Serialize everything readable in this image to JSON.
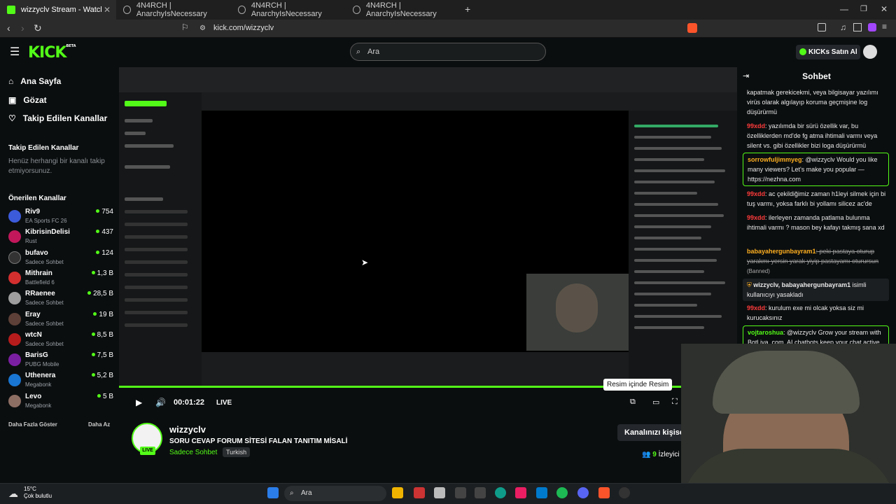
{
  "tabs": [
    {
      "title": "wizzyclv Stream - Watch Live on",
      "active": true
    },
    {
      "title": "4N4RCH | AnarchyIsNecessary"
    },
    {
      "title": "4N4RCH | AnarchyIsNecessary"
    },
    {
      "title": "4N4RCH | AnarchyIsNecessary"
    }
  ],
  "browser": {
    "url": "kick.com/wizzyclv",
    "new_tab": "+"
  },
  "header": {
    "logo": "KICK",
    "logo_sup": "BETA",
    "search_placeholder": "Ara",
    "buy_kicks": "KICKs Satın Al"
  },
  "sidebar": {
    "nav": [
      "Ana Sayfa",
      "Gözat",
      "Takip Edilen Kanallar"
    ],
    "followed_title": "Takip Edilen Kanallar",
    "followed_empty": "Henüz herhangi bir kanalı takip etmiyorsunuz.",
    "recommended_title": "Önerilen Kanallar",
    "channels": [
      {
        "name": "Riv9",
        "category": "EA Sports FC 26",
        "viewers": "754",
        "color": "#3b5bdb"
      },
      {
        "name": "KibrisinDelisi",
        "category": "Rust",
        "viewers": "437",
        "color": "#c2185b"
      },
      {
        "name": "bufavo",
        "category": "Sadece Sohbet",
        "viewers": "124",
        "color": "#333333"
      },
      {
        "name": "Mithrain",
        "category": "Battlefield 6",
        "viewers": "1,3 B",
        "color": "#d32f2f"
      },
      {
        "name": "RRaenee",
        "category": "Sadece Sohbet",
        "viewers": "28,5 B",
        "color": "#9e9e9e"
      },
      {
        "name": "Eray",
        "category": "Sadece Sohbet",
        "viewers": "19 B",
        "color": "#5d4037"
      },
      {
        "name": "wtcN",
        "category": "Sadece Sohbet",
        "viewers": "8,5 B",
        "color": "#b71c1c"
      },
      {
        "name": "BarisG",
        "category": "PUBG Mobile",
        "viewers": "7,5 B",
        "color": "#7b1fa2"
      },
      {
        "name": "Uthenera",
        "category": "Megabonk",
        "viewers": "5,2 B",
        "color": "#1976d2"
      },
      {
        "name": "Levo",
        "category": "Megabonk",
        "viewers": "5 B",
        "color": "#8d6e63"
      }
    ],
    "show_more": "Daha Fazla Göster",
    "show_less": "Daha Az"
  },
  "player": {
    "time": "00:01:22",
    "live": "LIVE",
    "tooltip": "Resim içinde Resim"
  },
  "stream": {
    "streamer": "wizzyclv",
    "title": "SORU CEVAP FORUM SİTESİ FALAN TANITIM MİSALİ",
    "category": "Sadece Sohbet",
    "tag": "Turkish",
    "customize": "Kanalınızı kişiselleştirin",
    "viewers_count": "9",
    "viewers_label": "İzleyici"
  },
  "chat": {
    "title": "Sohbet",
    "messages": [
      {
        "user": "",
        "text": "kapatmak gerekicekmi, veya bilgisayar yazılımı virüs olarak algılayıp koruma geçmişine log düşürürmü",
        "color": "#ffffff"
      },
      {
        "user": "99xdd",
        "text": ": yazılımda bir sürü özellik var, bu özelliklerden md'de fg atma ihtimali varmı veya silent vs. gibi özellikler bizi loga düşürürmü",
        "color": "#ff3b3b"
      },
      {
        "user": "sorrowfuljimmyeg",
        "text": ": @wizzyclv Would you like many viewers? Let's make you popular — https://nezhna.com",
        "color": "#ffb020"
      },
      {
        "user": "99xdd",
        "text": ": ac çekildiğimiz zaman h1leyi silmek için bi tuş varmı, yoksa farklı bi yollamı silicez ac'de",
        "color": "#ff3b3b"
      },
      {
        "user": "99xdd",
        "text": ": ilerleyen zamanda patlama bulunma ihtimali varmı ? mason bey kafayı takmış sana xd",
        "color": "#ff3b3b"
      },
      {
        "user": "babayahergunbayram1",
        "text": ": peki pastaya oturup yarakmı yersin yarak yiyip pastayamı oturursun",
        "color": "#ffb020",
        "deleted": "(Banned)"
      },
      {
        "user": "wizzyclv, babayahergunbayram1",
        "text": " isimli kullanıcıyı yasakladı",
        "color": "#ffffff"
      },
      {
        "user": "99xdd",
        "text": ": kurulum exe mi olcak yoksa siz mi kurucaksınız",
        "color": "#ff3b3b"
      },
      {
        "user": "vojtaroshua",
        "text": ": @wizzyclv Grow your stream with Botl iva .com. AI chatbots keep your chat active",
        "color": "#53fc18"
      }
    ]
  },
  "taskbar": {
    "temp": "15°C",
    "weather": "Çok bulutlu",
    "search_placeholder": "Ara"
  }
}
